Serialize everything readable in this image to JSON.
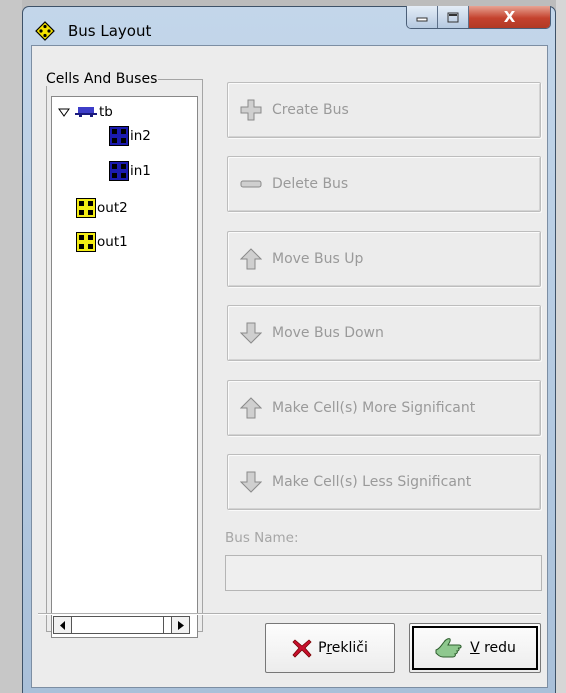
{
  "window": {
    "title": "Bus Layout",
    "close_glyph": "X"
  },
  "tree": {
    "group_label": "Cells And Buses",
    "nodes": [
      {
        "label": "tb",
        "icon": "bus-icon",
        "expanded": true
      },
      {
        "label": "in2",
        "icon": "input-cell-icon",
        "color": "#1b1bb0"
      },
      {
        "label": "in1",
        "icon": "input-cell-icon",
        "color": "#1b1bb0"
      },
      {
        "label": "out2",
        "icon": "output-cell-icon",
        "color": "#f3ec14"
      },
      {
        "label": "out1",
        "icon": "output-cell-icon",
        "color": "#f3ec14"
      }
    ]
  },
  "actions": {
    "create_bus": "Create Bus",
    "delete_bus": "Delete Bus",
    "move_up": "Move Bus Up",
    "move_down": "Move Bus Down",
    "more_significant": "Make Cell(s) More Significant",
    "less_significant": "Make Cell(s) Less Significant"
  },
  "bus_name": {
    "label": "Bus Name:",
    "value": ""
  },
  "buttons": {
    "cancel_mnemonic_pre": "P",
    "cancel_mnemonic": "r",
    "cancel_rest": "ekliči",
    "ok_mnemonic": "V",
    "ok_rest": " redu"
  },
  "colors": {
    "disabled_text": "#9a9a9a",
    "window_frame": "#b6cbe2",
    "close_button": "#c4422e"
  }
}
